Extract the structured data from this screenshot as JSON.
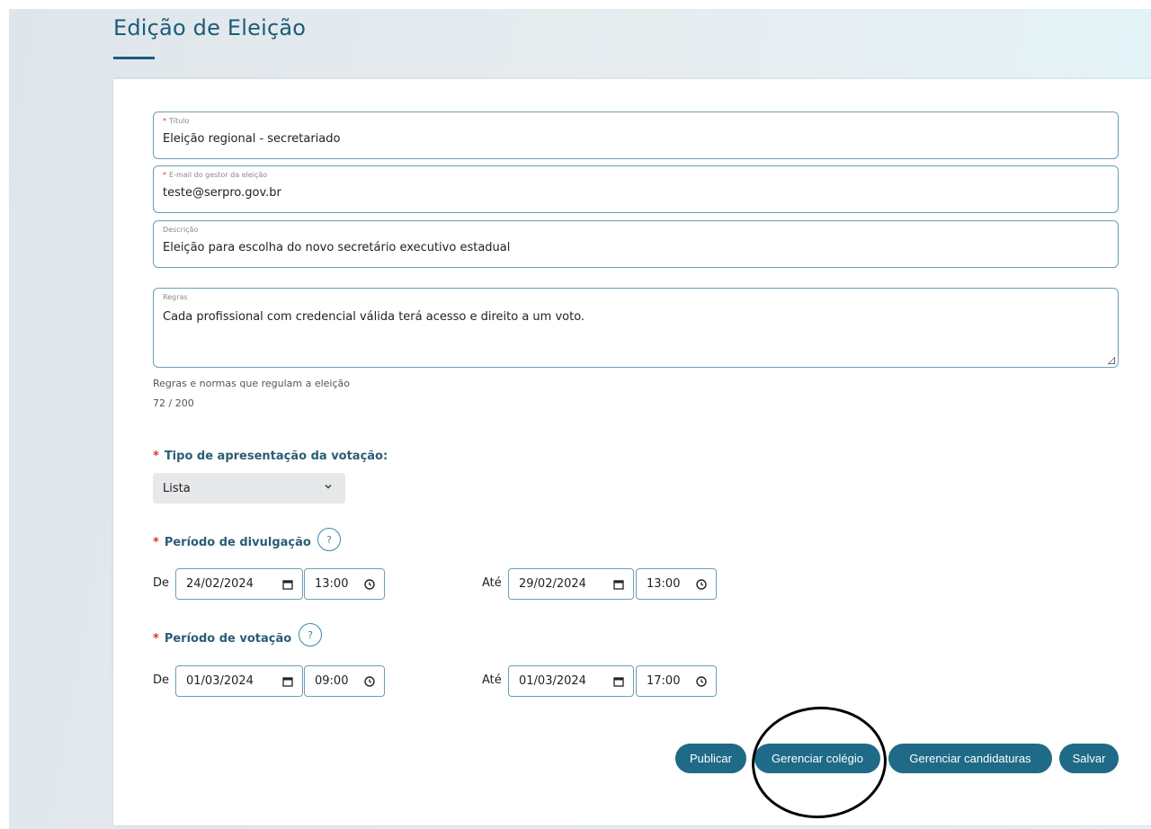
{
  "page": {
    "title": "Edição de Eleição"
  },
  "form": {
    "titulo": {
      "label": "Título",
      "required_mark": "*",
      "value": "Eleição regional - secretariado"
    },
    "email": {
      "label": "E-mail do gestor da eleição",
      "required_mark": "*",
      "value": "teste@serpro.gov.br"
    },
    "descricao": {
      "label": "Descrição",
      "value": "Eleição para escolha do novo secretário executivo estadual"
    },
    "regras": {
      "label": "Regras",
      "value": "Cada profissional com credencial válida terá acesso e direito a um voto.",
      "hint": "Regras e normas que regulam a eleição",
      "counter": "72 / 200"
    },
    "tipo_apresentacao": {
      "label": "Tipo de apresentação da votação:",
      "required_mark": "*",
      "selected": "Lista"
    },
    "periodo_divulgacao": {
      "label": "Período de divulgação",
      "required_mark": "*",
      "help": "?",
      "de_label": "De",
      "ate_label": "Até",
      "start_date": "24/02/2024",
      "start_time": "13:00",
      "end_date": "29/02/2024",
      "end_time": "13:00"
    },
    "periodo_votacao": {
      "label": "Período de votação",
      "required_mark": "*",
      "help": "?",
      "de_label": "De",
      "ate_label": "Até",
      "start_date": "01/03/2024",
      "start_time": "09:00",
      "end_date": "01/03/2024",
      "end_time": "17:00"
    }
  },
  "actions": {
    "publicar": "Publicar",
    "gerenciar_colegio": "Gerenciar colégio",
    "gerenciar_candidaturas": "Gerenciar candidaturas",
    "salvar": "Salvar"
  },
  "colors": {
    "accent": "#1e6a87",
    "title": "#1b5c7a",
    "field_border": "#6a9fb5",
    "required": "#dd3333"
  },
  "icons": {
    "select_chevron": "chevron-down-icon",
    "date_picker": "calendar-icon",
    "time_picker": "clock-icon",
    "help": "help-circle-icon"
  }
}
